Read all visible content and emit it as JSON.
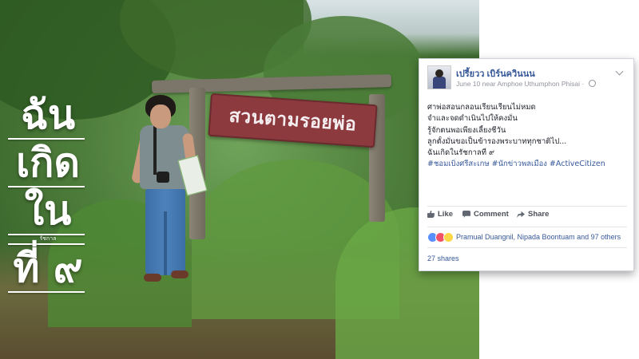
{
  "photo": {
    "sign_text": "สวนตามรอยพ่อ"
  },
  "title": {
    "lines": [
      "ฉัน",
      "เกิด",
      "ใน",
      "ที่ ๙"
    ],
    "small_label": "รัชกาล"
  },
  "post": {
    "author": "เปรี้ยวว เบิร์นควินนน",
    "meta": "June 10 near Amphoe Uthumphon Phisai",
    "body_lines": [
      "ศาพ่อสอนกลอนเรียนเรียนไม่หมด",
      "จำและจดดำเนินไปให้คงมั่น",
      "รู้จักตนพอเพียงเลี้ยงชีวัน",
      "ลูกตั้งมั่นขอเป็นข้ารองพระบาททุกชาติไป...",
      "ฉันเกิดในรัชกาลที่ ๙"
    ],
    "hashtags": "#ชอมเบิ่งศรีสะเกษ #นักข่าวพลเมือง #ActiveCitizen",
    "actions": {
      "like": "Like",
      "comment": "Comment",
      "share": "Share"
    },
    "reactions_text": "Pramual Duangnil, Nipada Boontuam and 97 others",
    "shares_text": "27 shares",
    "icons": [
      "like-icon",
      "comment-icon",
      "share-icon",
      "globe-icon",
      "chevron-down-icon"
    ],
    "colors": {
      "link": "#365899",
      "meta": "#90949c",
      "text": "#1d2129"
    }
  }
}
